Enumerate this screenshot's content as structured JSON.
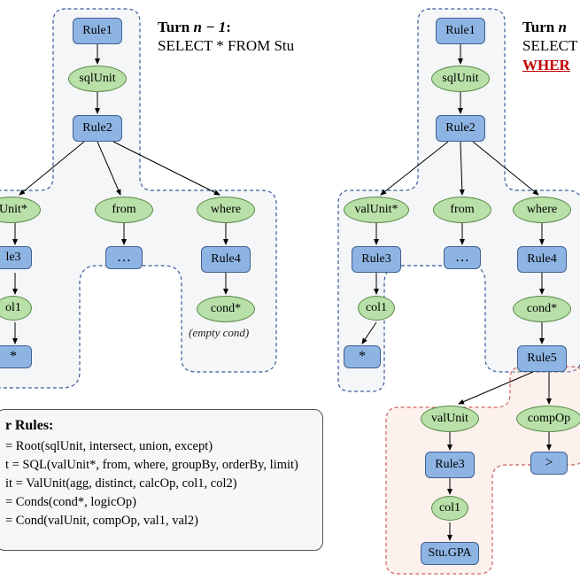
{
  "captions": {
    "left": {
      "title_prefix": "Turn ",
      "title_var": "n − 1",
      "title_colon": ":",
      "line2": "SELECT * FROM Stu"
    },
    "right": {
      "title_prefix": "Turn ",
      "title_var": "n",
      "line2": "SELECT",
      "line3": "WHER"
    }
  },
  "left_tree": {
    "rule1": "Rule1",
    "sqlUnit": "sqlUnit",
    "rule2": "Rule2",
    "valUnit": "lUnit*",
    "from": "from",
    "where": "where",
    "rule3": "le3",
    "fromDots": "…",
    "rule4": "Rule4",
    "col1": "ol1",
    "cond": "cond*",
    "star": "*"
  },
  "empty_cond": "(empty cond)",
  "right_tree": {
    "rule1": "Rule1",
    "sqlUnit": "sqlUnit",
    "rule2": "Rule2",
    "valUnit": "valUnit*",
    "from": "from",
    "where": "where",
    "rule3": "Rule3",
    "fromDots": "…",
    "rule4": "Rule4",
    "col1": "col1",
    "cond": "cond*",
    "star": "*",
    "rule5": "Rule5",
    "valUnit2": "valUnit",
    "compOp": "compOp",
    "rule3b": "Rule3",
    "gt": ">",
    "col1b": "col1",
    "stuGPA": "Stu.GPA"
  },
  "rules": {
    "title": "r Rules:",
    "r1": " = Root(sqlUnit, intersect, union, except)",
    "r2": "t = SQL(valUnit*, from, where, groupBy, orderBy, limit)",
    "r3": "it = ValUnit(agg, distinct, calcOp, col1, col2)",
    "r4": " = Conds(cond*, logicOp)",
    "r5": "= Cond(valUnit, compOp, val1, val2)"
  },
  "colors": {
    "cloud_gray_stroke": "#3a5b9b",
    "cloud_gray_fill": "#e1e4ea",
    "cloud_red_stroke": "#d06060",
    "cloud_red_fill": "#f6d6cc"
  }
}
